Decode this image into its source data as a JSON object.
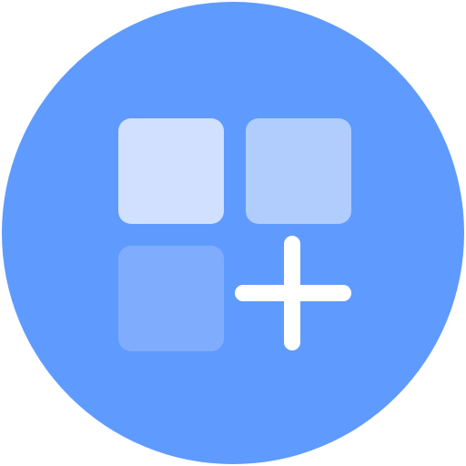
{
  "icon": {
    "name": "add-widget-icon",
    "colors": {
      "circle": "#5f9bfe",
      "tile_top_left": "#d1e0ff",
      "tile_top_right": "#b0cdfe",
      "tile_bottom_left": "#80acfe",
      "plus": "#ffffff"
    }
  }
}
